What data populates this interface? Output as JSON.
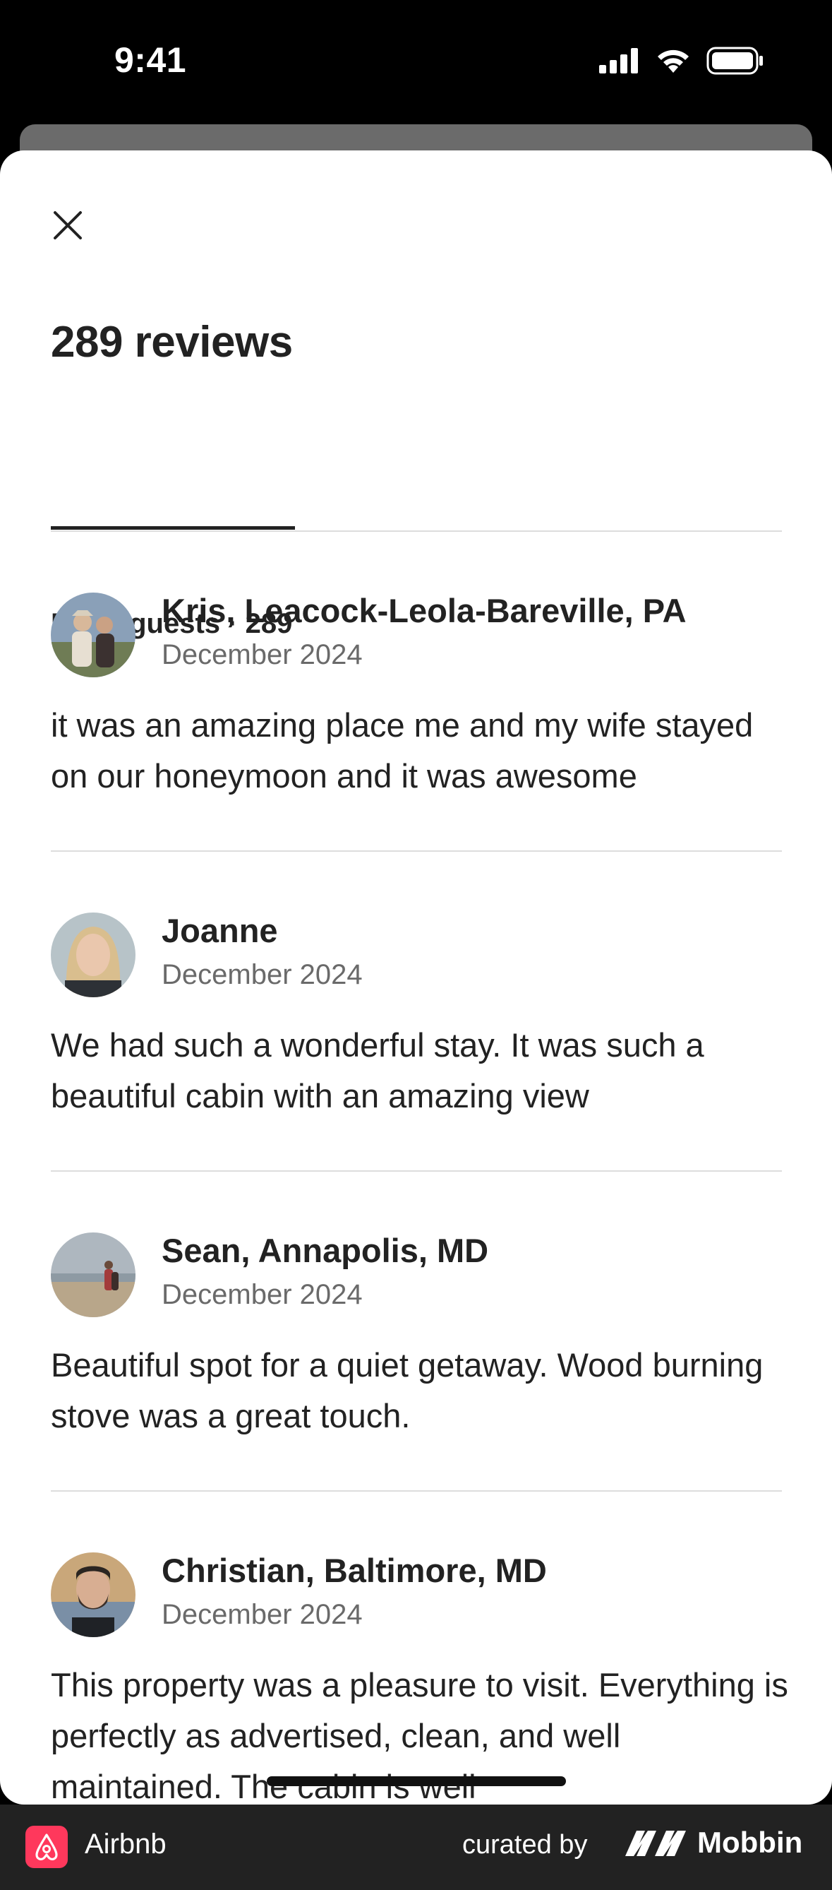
{
  "status_bar": {
    "time": "9:41"
  },
  "sheet": {
    "title": "289 reviews",
    "tab_label": "From guests · 289"
  },
  "reviews": [
    {
      "name": "Kris, Leacock-Leola-Bareville, PA",
      "date": "December 2024",
      "text": "it was an amazing place me and my wife stayed on our honeymoon and it was awesome"
    },
    {
      "name": "Joanne",
      "date": "December 2024",
      "text": "We had such a wonderful stay. It was such a beautiful cabin with an amazing view"
    },
    {
      "name": "Sean, Annapolis, MD",
      "date": "December 2024",
      "text": "Beautiful spot for a quiet getaway. Wood burning stove was a great touch."
    },
    {
      "name": "Christian, Baltimore, MD",
      "date": "December 2024",
      "text": "This property was a pleasure to visit. Everything is perfectly as advertised, clean, and well maintained. The cabin is well"
    }
  ],
  "footer": {
    "app_name": "Airbnb",
    "curated_by": "curated by",
    "brand": "Mobbin"
  },
  "colors": {
    "airbnb_brand": "#ff385c",
    "text_primary": "#222222",
    "text_secondary": "#6a6a6a",
    "divider": "#dddddd"
  }
}
